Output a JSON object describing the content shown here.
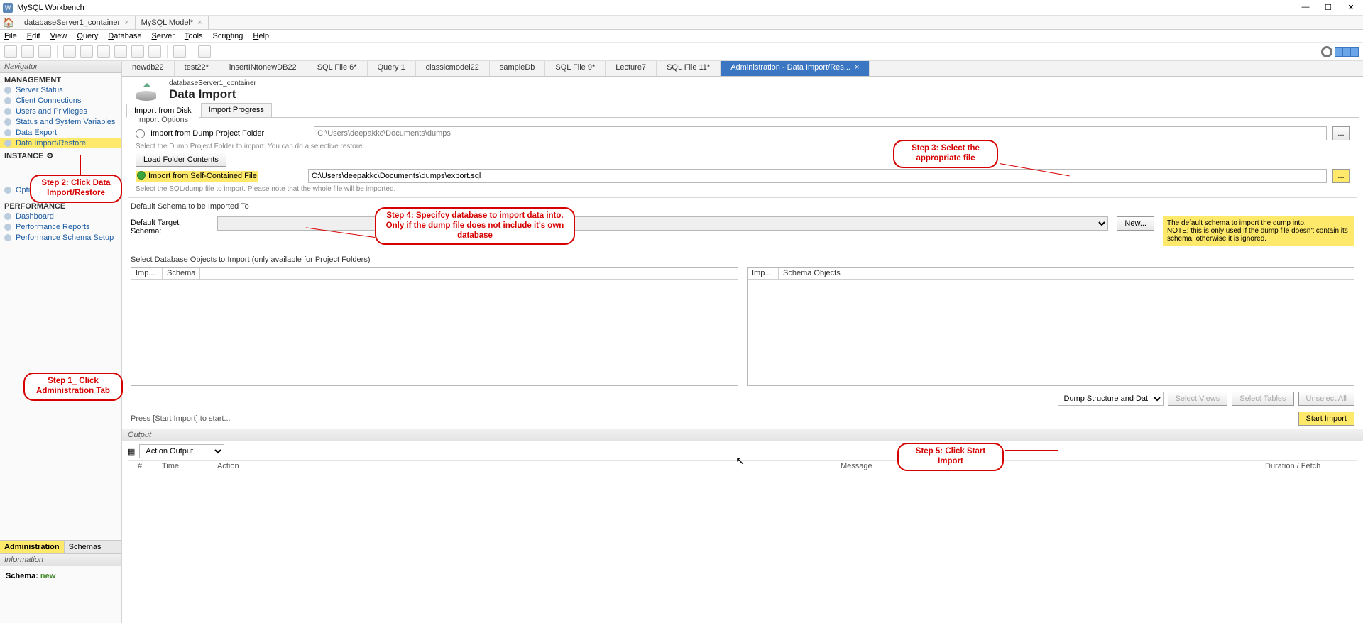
{
  "window": {
    "title": "MySQL Workbench",
    "minimize": "—",
    "maximize": "☐",
    "close": "✕"
  },
  "doc_tabs": [
    {
      "label": "databaseServer1_container",
      "closable": true
    },
    {
      "label": "MySQL Model*",
      "closable": true
    }
  ],
  "menu": [
    "File",
    "Edit",
    "View",
    "Query",
    "Database",
    "Server",
    "Tools",
    "Scripting",
    "Help"
  ],
  "toolbar_right": {
    "gear": "settings",
    "panes": 3
  },
  "navigator": {
    "header": "Navigator",
    "sections": {
      "management": {
        "title": "MANAGEMENT",
        "items": [
          "Server Status",
          "Client Connections",
          "Users and Privileges",
          "Status and System Variables",
          "Data Export",
          "Data Import/Restore"
        ],
        "highlight_index": 5
      },
      "instance": {
        "title": "INSTANCE",
        "icon": "⌂",
        "items": [
          "Options File"
        ],
        "note_hidden": true
      },
      "performance": {
        "title": "PERFORMANCE",
        "items": [
          "Dashboard",
          "Performance Reports",
          "Performance Schema Setup"
        ]
      }
    },
    "bottom_tabs": {
      "admin": "Administration",
      "schemas": "Schemas",
      "active": "admin"
    },
    "info_header": "Information",
    "schema_label": "Schema:",
    "schema_value": "new"
  },
  "editor_tabs": [
    "newdb22",
    "test22*",
    "insertINtonewDB22",
    "SQL File 6*",
    "Query 1",
    "classicmodel22",
    "sampleDb",
    "SQL File 9*",
    "Lecture7",
    "SQL File 11*"
  ],
  "editor_tab_active": {
    "label": "Administration - Data Import/Res...",
    "close": "×"
  },
  "page": {
    "server": "databaseServer1_container",
    "title": "Data Import",
    "subtabs": {
      "disk": "Import from Disk",
      "progress": "Import Progress",
      "active": "disk"
    }
  },
  "options": {
    "group_title": "Import Options",
    "folder": {
      "label": "Import from Dump Project Folder",
      "path": "C:\\Users\\deepakkc\\Documents\\dumps",
      "help": "Select the Dump Project Folder to import. You can do a selective restore.",
      "load_btn": "Load Folder Contents",
      "browse": "..."
    },
    "file": {
      "label": "Import from Self-Contained File",
      "path": "C:\\Users\\deepakkc\\Documents\\dumps\\export.sql",
      "help": "Select the SQL/dump file to import. Please note that the whole file will be imported.",
      "browse": "..."
    }
  },
  "schema": {
    "section_label": "Default Schema to be Imported To",
    "label": "Default Target Schema:",
    "new_btn": "New...",
    "note": "The default schema to import the dump into.\nNOTE: this is only used if the dump file doesn't contain its schema, otherwise it is ignored."
  },
  "objects": {
    "section_label": "Select Database Objects to Import (only available for Project Folders)",
    "left_cols": {
      "imp": "Imp...",
      "schema": "Schema"
    },
    "right_cols": {
      "imp": "Imp...",
      "schema": "Schema Objects"
    },
    "dump_type": "Dump Structure and Dat",
    "select_views": "Select Views",
    "select_tables": "Select Tables",
    "unselect_all": "Unselect All"
  },
  "start": {
    "msg": "Press [Start Import] to start...",
    "btn": "Start Import"
  },
  "output": {
    "header": "Output",
    "dropdown": "Action Output",
    "cols": {
      "sharp": "#",
      "time": "Time",
      "action": "Action",
      "msg": "Message",
      "dur": "Duration / Fetch"
    }
  },
  "callouts": {
    "step1": "Step 1_ Click Administration Tab",
    "step2": "Step 2: Click Data Import/Restore",
    "step3": "Step 3: Select the appropriate file",
    "step4": "Step 4: Specifcy database to import data into. Only if the dump file does not include it's own database",
    "step5": "Step 5: Click Start Import"
  }
}
